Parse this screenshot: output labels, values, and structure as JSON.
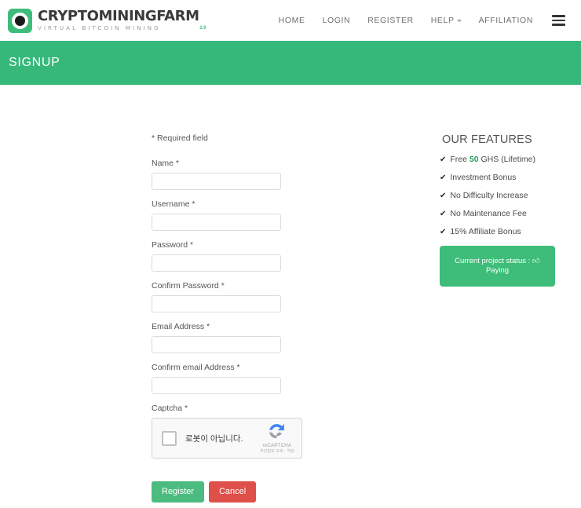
{
  "header": {
    "logo": {
      "title": "CRYPTOMININGFARM",
      "subtitle": "VIRTUAL BITCOIN MINING",
      "version": "2.0",
      "mark_color": "#3dbd79"
    },
    "nav": [
      {
        "label": "HOME",
        "has_caret": false
      },
      {
        "label": "LOGIN",
        "has_caret": false
      },
      {
        "label": "REGISTER",
        "has_caret": false
      },
      {
        "label": "HELP",
        "has_caret": true
      },
      {
        "label": "AFFILIATION",
        "has_caret": false
      }
    ],
    "menu_icon": "hamburger-icon"
  },
  "banner": {
    "title": "SIGNUP",
    "background": "#36b87a"
  },
  "form": {
    "required_note": "* Required field",
    "fields": [
      {
        "label": "Name *",
        "value": "",
        "placeholder": "",
        "name": "name"
      },
      {
        "label": "Username *",
        "value": "",
        "placeholder": "",
        "name": "username"
      },
      {
        "label": "Password *",
        "value": "",
        "placeholder": "",
        "name": "password"
      },
      {
        "label": "Confirm Password *",
        "value": "",
        "placeholder": "",
        "name": "confirm-password"
      },
      {
        "label": "Email Address *",
        "value": "",
        "placeholder": "",
        "name": "email"
      },
      {
        "label": "Confirm email Address *",
        "value": "",
        "placeholder": "",
        "name": "confirm-email"
      }
    ],
    "captcha": {
      "label": "Captcha *",
      "checkbox_label": "로봇이 아닙니다.",
      "brand_name": "reCAPTCHA",
      "terms": "개인정보 보호 - 약관",
      "checked": false
    },
    "buttons": {
      "register": {
        "label": "Register",
        "color": "#4cbb7f"
      },
      "cancel": {
        "label": "Cancel",
        "color": "#e0504a"
      }
    }
  },
  "sidebar": {
    "features_title": "OUR FEATURES",
    "features": [
      {
        "pre": "Free ",
        "highlight": "50",
        "post": " GHS (Lifetime)"
      },
      {
        "pre": "Investment Bonus",
        "highlight": "",
        "post": ""
      },
      {
        "pre": "No Difficulty Increase",
        "highlight": "",
        "post": ""
      },
      {
        "pre": "No Maintenance Fee",
        "highlight": "",
        "post": ""
      },
      {
        "pre": "15% Affiliate Bonus",
        "highlight": "",
        "post": ""
      }
    ],
    "status": {
      "prefix": "Current project status : ",
      "icon": "thumbs-up-icon",
      "value": "Paying",
      "background": "#3dbd79"
    }
  }
}
